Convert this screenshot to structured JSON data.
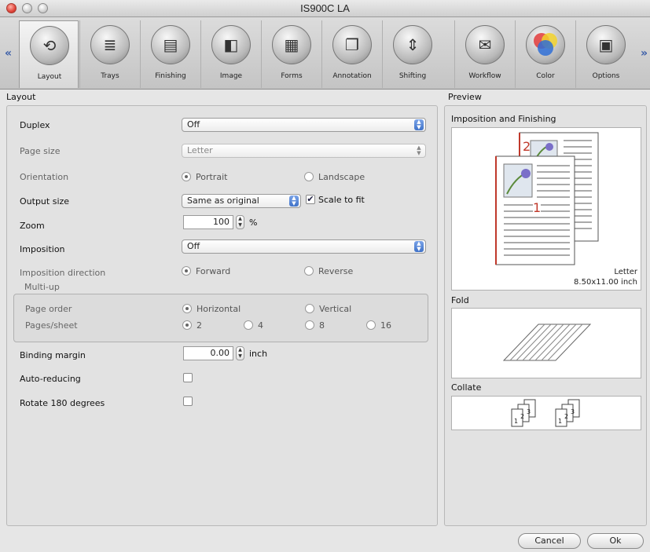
{
  "window": {
    "title": "IS900C LA"
  },
  "toolbar": {
    "tabs": [
      {
        "label": "Layout",
        "icon": "layout-icon"
      },
      {
        "label": "Trays",
        "icon": "trays-icon"
      },
      {
        "label": "Finishing",
        "icon": "finishing-icon"
      },
      {
        "label": "Image",
        "icon": "image-icon"
      },
      {
        "label": "Forms",
        "icon": "forms-icon"
      },
      {
        "label": "Annotation",
        "icon": "annotation-icon"
      },
      {
        "label": "Shifting",
        "icon": "shifting-icon"
      },
      {
        "label": "Workflow",
        "icon": "workflow-icon"
      },
      {
        "label": "Color",
        "icon": "color-icon"
      },
      {
        "label": "Options",
        "icon": "options-icon"
      }
    ],
    "selected": "Layout",
    "scroll_left": "«",
    "scroll_right": "»"
  },
  "layout": {
    "section_title": "Layout",
    "duplex": {
      "label": "Duplex",
      "value": "Off"
    },
    "page_size": {
      "label": "Page size",
      "value": "Letter"
    },
    "orientation": {
      "label": "Orientation",
      "options": [
        "Portrait",
        "Landscape"
      ],
      "selected": "Portrait"
    },
    "output_size": {
      "label": "Output size",
      "value": "Same as original",
      "scale_to_fit_label": "Scale to fit",
      "scale_to_fit": true
    },
    "zoom": {
      "label": "Zoom",
      "value": "100",
      "unit": "%"
    },
    "imposition": {
      "label": "Imposition",
      "value": "Off"
    },
    "imposition_direction": {
      "label": "Imposition direction",
      "options": [
        "Forward",
        "Reverse"
      ],
      "selected": "Forward"
    },
    "multiup": {
      "title": "Multi-up",
      "page_order": {
        "label": "Page order",
        "options": [
          "Horizontal",
          "Vertical"
        ],
        "selected": "Horizontal"
      },
      "pages_sheet": {
        "label": "Pages/sheet",
        "options": [
          "2",
          "4",
          "8",
          "16"
        ],
        "selected": "2"
      }
    },
    "binding_margin": {
      "label": "Binding margin",
      "value": "0.00",
      "unit": "inch"
    },
    "auto_reducing": {
      "label": "Auto-reducing",
      "checked": false
    },
    "rotate_180": {
      "label": "Rotate 180 degrees",
      "checked": false
    }
  },
  "preview": {
    "section_title": "Preview",
    "imposition_title": "Imposition and Finishing",
    "page_num_front": "1",
    "page_num_back": "2",
    "paper_name": "Letter",
    "paper_size": "8.50x11.00 inch",
    "fold_title": "Fold",
    "collate_title": "Collate",
    "collate_sets": [
      [
        "1",
        "2",
        "3"
      ],
      [
        "1",
        "2",
        "3"
      ]
    ]
  },
  "buttons": {
    "cancel": "Cancel",
    "ok": "Ok"
  },
  "colors": {
    "accent": "#3f72c8",
    "page_number": "#c0392b"
  }
}
